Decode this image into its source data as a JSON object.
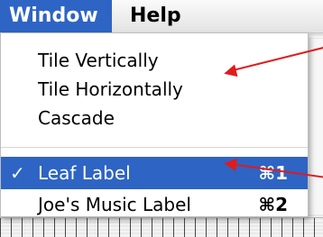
{
  "menubar": {
    "window_label": "Window",
    "help_label": "Help"
  },
  "window_menu": {
    "items": [
      {
        "label": "Tile Vertically",
        "check": "",
        "shortcut": ""
      },
      {
        "label": "Tile Horizontally",
        "check": "",
        "shortcut": ""
      },
      {
        "label": "Cascade",
        "check": "",
        "shortcut": ""
      },
      {
        "label": "Leaf Label",
        "check": "✓",
        "shortcut": "⌘1"
      },
      {
        "label": "Joe's Music Label",
        "check": "",
        "shortcut": "⌘2"
      }
    ]
  },
  "colors": {
    "selection": "#2e64c4",
    "annotation_arrow": "#e01b1b"
  }
}
